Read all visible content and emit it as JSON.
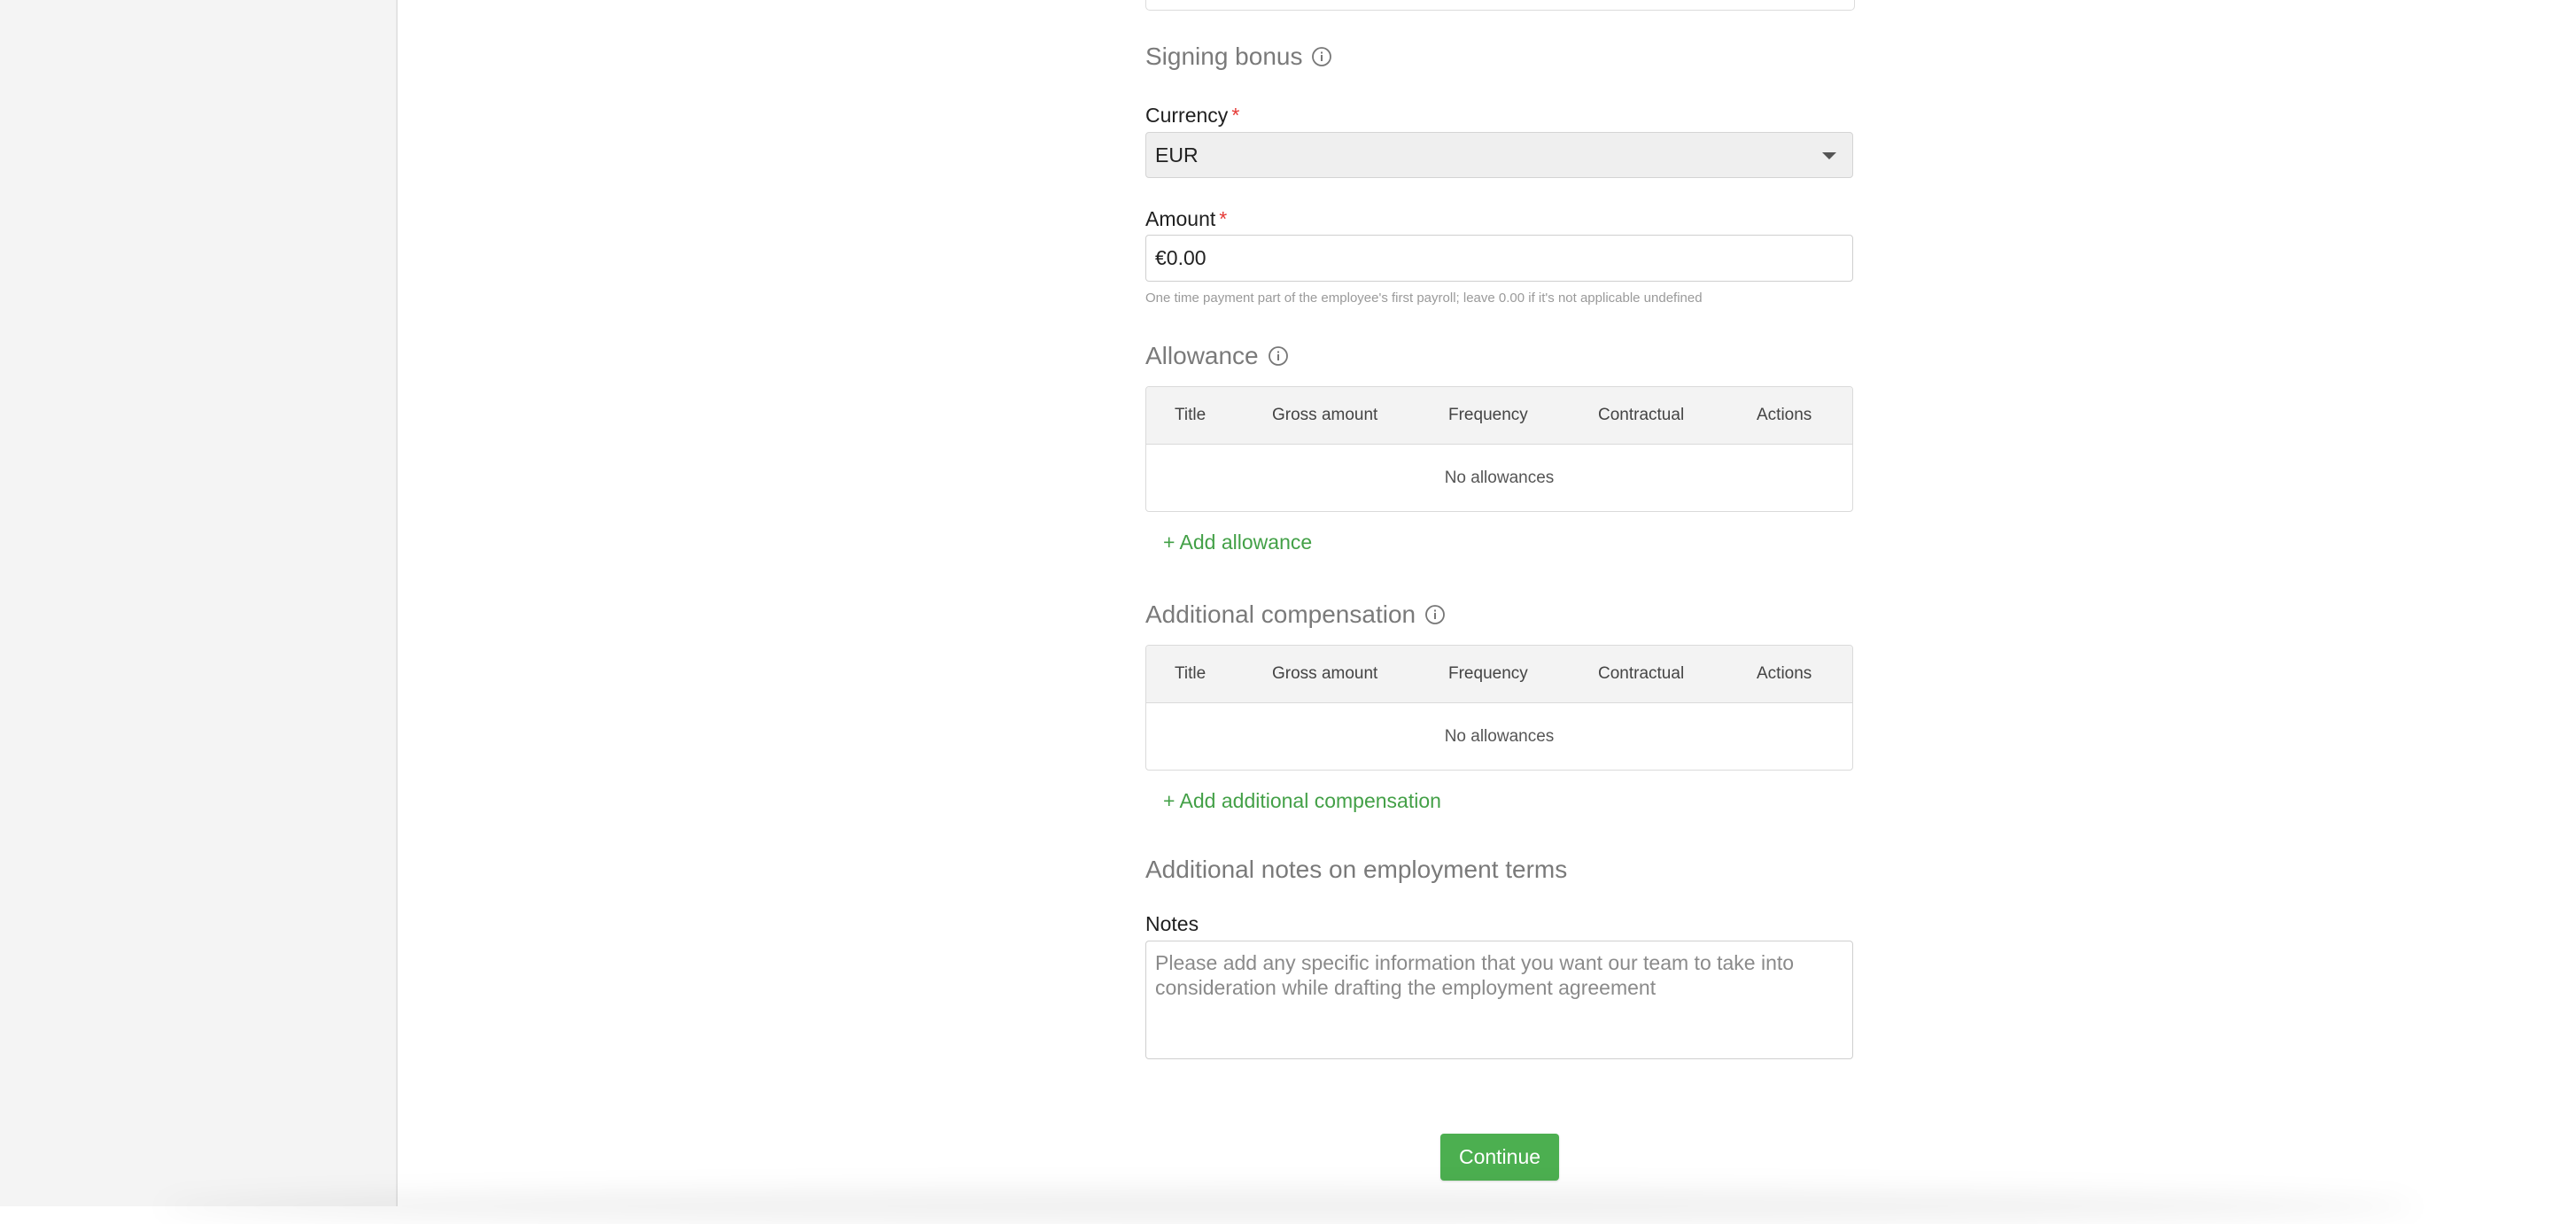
{
  "signing_bonus": {
    "title": "Signing bonus",
    "currency_label": "Currency",
    "currency_value": "EUR",
    "amount_label": "Amount",
    "amount_value": "€0.00",
    "required_mark": "*",
    "hint": "One time payment part of the employee's first payroll; leave 0.00 if it's not applicable undefined"
  },
  "allowance": {
    "title": "Allowance",
    "columns": [
      "Title",
      "Gross amount",
      "Frequency",
      "Contractual",
      "Actions"
    ],
    "empty_text": "No allowances",
    "add_label": "+ Add allowance"
  },
  "additional_compensation": {
    "title": "Additional compensation",
    "columns": [
      "Title",
      "Gross amount",
      "Frequency",
      "Contractual",
      "Actions"
    ],
    "empty_text": "No allowances",
    "add_label": "+ Add additional compensation"
  },
  "notes": {
    "section_title": "Additional notes on employment terms",
    "label": "Notes",
    "placeholder": "Please add any specific information that you want our team to take into consideration while drafting the employment agreement"
  },
  "actions": {
    "continue_label": "Continue"
  },
  "colors": {
    "accent_green": "#4caf50",
    "link_green": "#43a047",
    "required_red": "#e53935"
  },
  "icons": [
    "info-icon",
    "chevron-down-icon"
  ]
}
